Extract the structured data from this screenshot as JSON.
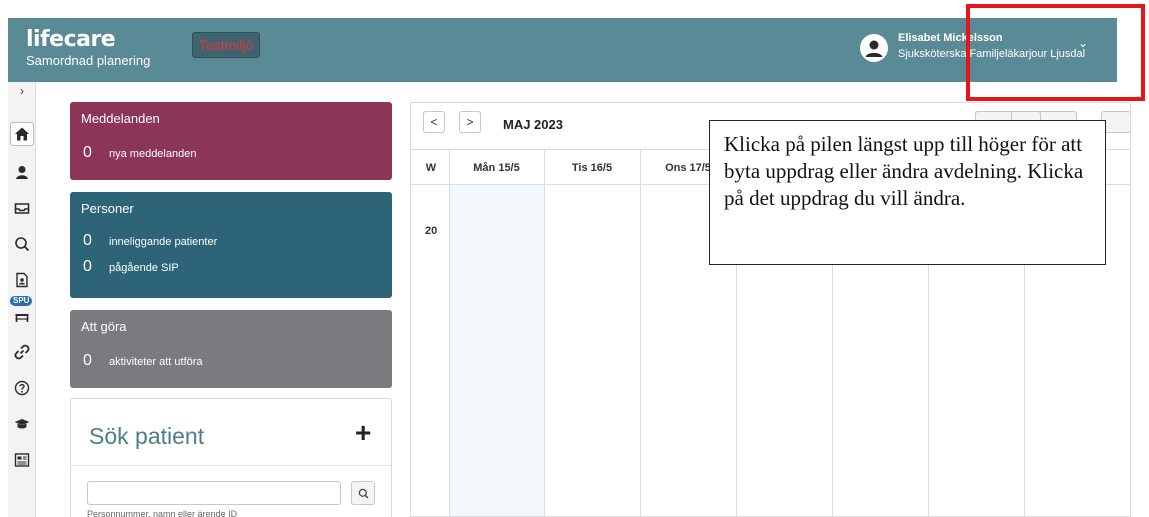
{
  "header": {
    "brand_name": "lifecare",
    "brand_sub": "Samordnad planering",
    "env_badge": "Testmiljö",
    "user_name": "Elisabet Mickelsson",
    "user_role": "Sjuksköterska Familjeläkarjour Ljusdal",
    "chevron": "⌄"
  },
  "sidebar": {
    "toggle": "›",
    "spu_badge": "SPU",
    "icons": [
      "home-icon",
      "user-icon",
      "inbox-icon",
      "search-icon",
      "patient-record-icon",
      "bed-icon",
      "link-icon",
      "help-icon",
      "graduation-cap-icon",
      "news-icon"
    ]
  },
  "cards": {
    "messages": {
      "title": "Meddelanden",
      "count": "0",
      "label": "nya meddelanden",
      "color": "#8c3556"
    },
    "persons": {
      "title": "Personer",
      "rows": [
        {
          "count": "0",
          "label": "inneliggande patienter"
        },
        {
          "count": "0",
          "label": "pågående SIP"
        }
      ],
      "color": "#2d6478"
    },
    "todo": {
      "title": "Att göra",
      "count": "0",
      "label": "aktiviteter att utföra",
      "color": "#7b7b7f"
    }
  },
  "search": {
    "title": "Sök patient",
    "plus": "+",
    "placeholder": "",
    "hint": "Personnummer, namn eller ärende ID"
  },
  "calendar": {
    "prev": "<",
    "next": ">",
    "month": "MAJ 2023",
    "week_col": "W",
    "days": [
      "Mån 15/5",
      "Tis 16/5",
      "Ons 17/5"
    ],
    "week_number": "20"
  },
  "callout": {
    "text": "Klicka på pilen längst upp till höger för att byta uppdrag eller ändra avdelning. Klicka på det uppdrag du vill ändra."
  },
  "colors": {
    "header_bg": "#5a8a96",
    "highlight": "#e8141c",
    "brand_accent": "#4c7e89"
  }
}
